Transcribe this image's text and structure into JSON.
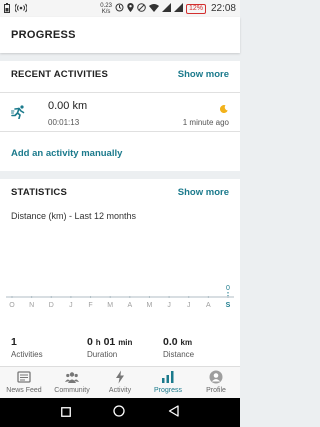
{
  "status_bar": {
    "speed_value": "0.23",
    "speed_unit": "K/s",
    "battery": "12%",
    "time": "22:08"
  },
  "header": {
    "title": "PROGRESS"
  },
  "recent": {
    "title": "RECENT ACTIVITIES",
    "show_more": "Show more",
    "activity": {
      "distance": "0.00 km",
      "duration": "00:01:13",
      "ago": "1 minute ago",
      "icon": "running-icon",
      "weather_icon": "moon-icon"
    },
    "add_manual": "Add an activity manually"
  },
  "statistics": {
    "title": "STATISTICS",
    "show_more": "Show more",
    "subtitle": "Distance (km) - Last 12 months",
    "summary": {
      "activities_value": "1",
      "activities_label": "Activities",
      "duration_h": "0",
      "duration_h_unit": "h",
      "duration_m": "01",
      "duration_m_unit": "min",
      "duration_label": "Duration",
      "distance_value": "0.0",
      "distance_unit": "km",
      "distance_label": "Distance"
    }
  },
  "chart_data": {
    "type": "bar",
    "categories": [
      "O",
      "N",
      "D",
      "J",
      "F",
      "M",
      "A",
      "M",
      "J",
      "J",
      "A",
      "S"
    ],
    "values": [
      0,
      0,
      0,
      0,
      0,
      0,
      0,
      0,
      0,
      0,
      0,
      0
    ],
    "data_labels": [
      "",
      "",
      "",
      "",
      "",
      "",
      "",
      "",
      "",
      "",
      "",
      "0"
    ],
    "highlight_index": 11,
    "colors": {
      "axis": "#b0bec5",
      "highlight": "#1b7a8c"
    }
  },
  "bottom_nav": [
    {
      "label": "News Feed",
      "icon": "newsfeed-icon"
    },
    {
      "label": "Community",
      "icon": "community-icon"
    },
    {
      "label": "Activity",
      "icon": "bolt-icon"
    },
    {
      "label": "Progress",
      "icon": "progress-chart-icon"
    },
    {
      "label": "Profile",
      "icon": "profile-icon"
    }
  ],
  "colors": {
    "accent": "#1b7a8c"
  }
}
